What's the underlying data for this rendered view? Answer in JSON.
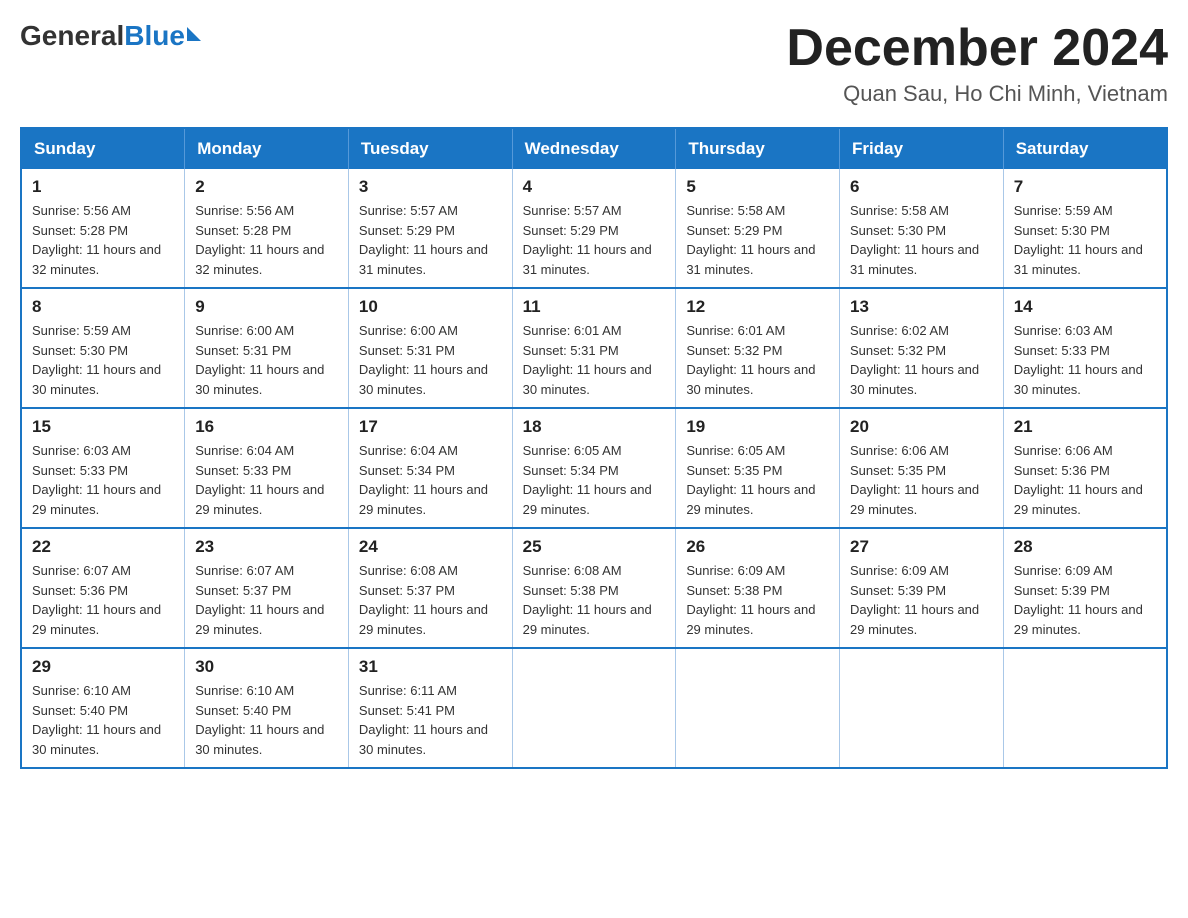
{
  "header": {
    "logo": {
      "general": "General",
      "blue": "Blue"
    },
    "title": "December 2024",
    "location": "Quan Sau, Ho Chi Minh, Vietnam"
  },
  "calendar": {
    "days_of_week": [
      "Sunday",
      "Monday",
      "Tuesday",
      "Wednesday",
      "Thursday",
      "Friday",
      "Saturday"
    ],
    "weeks": [
      [
        {
          "day": "1",
          "sunrise": "5:56 AM",
          "sunset": "5:28 PM",
          "daylight": "11 hours and 32 minutes."
        },
        {
          "day": "2",
          "sunrise": "5:56 AM",
          "sunset": "5:28 PM",
          "daylight": "11 hours and 32 minutes."
        },
        {
          "day": "3",
          "sunrise": "5:57 AM",
          "sunset": "5:29 PM",
          "daylight": "11 hours and 31 minutes."
        },
        {
          "day": "4",
          "sunrise": "5:57 AM",
          "sunset": "5:29 PM",
          "daylight": "11 hours and 31 minutes."
        },
        {
          "day": "5",
          "sunrise": "5:58 AM",
          "sunset": "5:29 PM",
          "daylight": "11 hours and 31 minutes."
        },
        {
          "day": "6",
          "sunrise": "5:58 AM",
          "sunset": "5:30 PM",
          "daylight": "11 hours and 31 minutes."
        },
        {
          "day": "7",
          "sunrise": "5:59 AM",
          "sunset": "5:30 PM",
          "daylight": "11 hours and 31 minutes."
        }
      ],
      [
        {
          "day": "8",
          "sunrise": "5:59 AM",
          "sunset": "5:30 PM",
          "daylight": "11 hours and 30 minutes."
        },
        {
          "day": "9",
          "sunrise": "6:00 AM",
          "sunset": "5:31 PM",
          "daylight": "11 hours and 30 minutes."
        },
        {
          "day": "10",
          "sunrise": "6:00 AM",
          "sunset": "5:31 PM",
          "daylight": "11 hours and 30 minutes."
        },
        {
          "day": "11",
          "sunrise": "6:01 AM",
          "sunset": "5:31 PM",
          "daylight": "11 hours and 30 minutes."
        },
        {
          "day": "12",
          "sunrise": "6:01 AM",
          "sunset": "5:32 PM",
          "daylight": "11 hours and 30 minutes."
        },
        {
          "day": "13",
          "sunrise": "6:02 AM",
          "sunset": "5:32 PM",
          "daylight": "11 hours and 30 minutes."
        },
        {
          "day": "14",
          "sunrise": "6:03 AM",
          "sunset": "5:33 PM",
          "daylight": "11 hours and 30 minutes."
        }
      ],
      [
        {
          "day": "15",
          "sunrise": "6:03 AM",
          "sunset": "5:33 PM",
          "daylight": "11 hours and 29 minutes."
        },
        {
          "day": "16",
          "sunrise": "6:04 AM",
          "sunset": "5:33 PM",
          "daylight": "11 hours and 29 minutes."
        },
        {
          "day": "17",
          "sunrise": "6:04 AM",
          "sunset": "5:34 PM",
          "daylight": "11 hours and 29 minutes."
        },
        {
          "day": "18",
          "sunrise": "6:05 AM",
          "sunset": "5:34 PM",
          "daylight": "11 hours and 29 minutes."
        },
        {
          "day": "19",
          "sunrise": "6:05 AM",
          "sunset": "5:35 PM",
          "daylight": "11 hours and 29 minutes."
        },
        {
          "day": "20",
          "sunrise": "6:06 AM",
          "sunset": "5:35 PM",
          "daylight": "11 hours and 29 minutes."
        },
        {
          "day": "21",
          "sunrise": "6:06 AM",
          "sunset": "5:36 PM",
          "daylight": "11 hours and 29 minutes."
        }
      ],
      [
        {
          "day": "22",
          "sunrise": "6:07 AM",
          "sunset": "5:36 PM",
          "daylight": "11 hours and 29 minutes."
        },
        {
          "day": "23",
          "sunrise": "6:07 AM",
          "sunset": "5:37 PM",
          "daylight": "11 hours and 29 minutes."
        },
        {
          "day": "24",
          "sunrise": "6:08 AM",
          "sunset": "5:37 PM",
          "daylight": "11 hours and 29 minutes."
        },
        {
          "day": "25",
          "sunrise": "6:08 AM",
          "sunset": "5:38 PM",
          "daylight": "11 hours and 29 minutes."
        },
        {
          "day": "26",
          "sunrise": "6:09 AM",
          "sunset": "5:38 PM",
          "daylight": "11 hours and 29 minutes."
        },
        {
          "day": "27",
          "sunrise": "6:09 AM",
          "sunset": "5:39 PM",
          "daylight": "11 hours and 29 minutes."
        },
        {
          "day": "28",
          "sunrise": "6:09 AM",
          "sunset": "5:39 PM",
          "daylight": "11 hours and 29 minutes."
        }
      ],
      [
        {
          "day": "29",
          "sunrise": "6:10 AM",
          "sunset": "5:40 PM",
          "daylight": "11 hours and 30 minutes."
        },
        {
          "day": "30",
          "sunrise": "6:10 AM",
          "sunset": "5:40 PM",
          "daylight": "11 hours and 30 minutes."
        },
        {
          "day": "31",
          "sunrise": "6:11 AM",
          "sunset": "5:41 PM",
          "daylight": "11 hours and 30 minutes."
        },
        null,
        null,
        null,
        null
      ]
    ]
  }
}
